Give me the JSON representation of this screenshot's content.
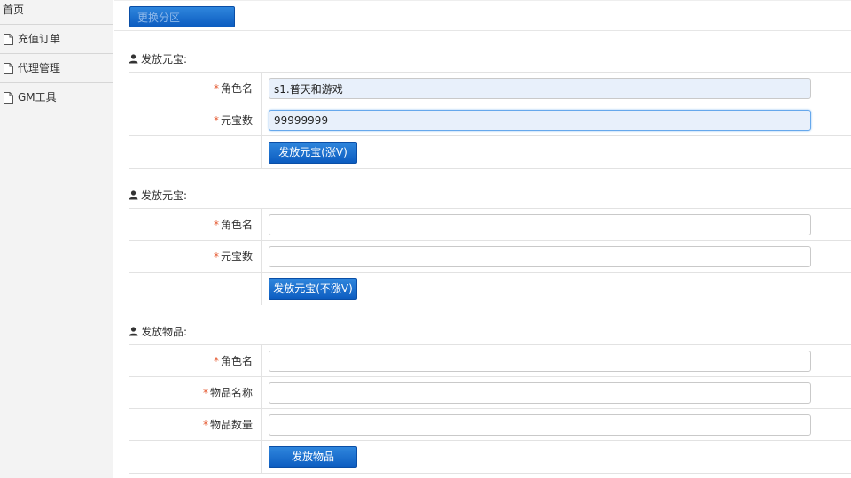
{
  "sidebar": {
    "home": "首页",
    "items": [
      {
        "label": "充值订单",
        "icon": "document-icon"
      },
      {
        "label": "代理管理",
        "icon": "document-icon"
      },
      {
        "label": "GM工具",
        "icon": "document-icon"
      }
    ]
  },
  "topbar": {
    "zone_button": "更换分区"
  },
  "section1": {
    "title": "发放元宝:",
    "role_label": "角色名",
    "role_value": "s1.普天和游戏",
    "amount_label": "元宝数",
    "amount_value": "99999999",
    "submit": "发放元宝(涨V)"
  },
  "section2": {
    "title": "发放元宝:",
    "role_label": "角色名",
    "role_value": "",
    "amount_label": "元宝数",
    "amount_value": "",
    "submit": "发放元宝(不涨V)"
  },
  "section3": {
    "title": "发放物品:",
    "role_label": "角色名",
    "role_value": "",
    "item_name_label": "物品名称",
    "item_name_value": "",
    "item_qty_label": "物品数量",
    "item_qty_value": "",
    "submit": "发放物品"
  },
  "required_mark": "*",
  "colors": {
    "accent": "#0c5cc0",
    "required": "#e4572e",
    "sidebar_bg": "#f3f3f3"
  }
}
